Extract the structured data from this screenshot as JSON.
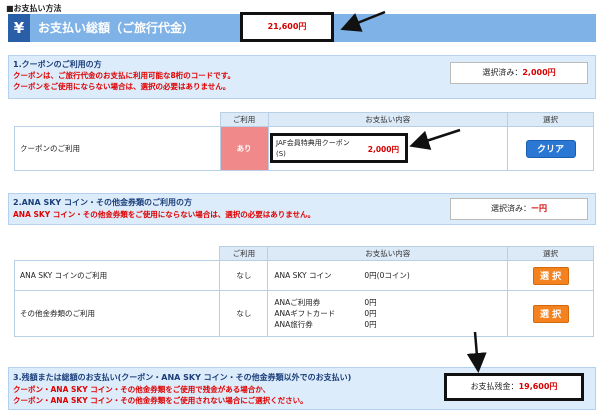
{
  "page_title": "■お支払い方法",
  "total": {
    "yen_symbol": "¥",
    "label": "お支払い総額（ご旅行代金）",
    "amount": "21,600円"
  },
  "coupon_section": {
    "title": "1.クーポンのご利用の方",
    "note1": "クーポンは、ご旅行代金のお支払に利用可能な8桁のコードです。",
    "note2": "クーポンをご使用にならない場合は、選択の必要はありません。",
    "selected_prefix": "選択済み：",
    "selected_amount": "2,000円",
    "headers": {
      "use": "ご利用",
      "content": "お支払い内容",
      "select": "選択"
    },
    "row": {
      "label": "クーポンのご利用",
      "use": "あり",
      "item_name": "JAF会員特典用クーポン(S)",
      "item_amount": "2,000円",
      "button": "クリア"
    }
  },
  "ana_section": {
    "title": "2.ANA SKY コイン・その他金券類のご利用の方",
    "note": "ANA SKY コイン・その他金券類をご使用にならない場合は、選択の必要はありません。",
    "selected_prefix": "選択済み：",
    "selected_amount": "ー円",
    "headers": {
      "use": "ご利用",
      "content": "お支払い内容",
      "select": "選択"
    },
    "rows": [
      {
        "label": "ANA SKY コインのご利用",
        "use": "なし",
        "items": [
          {
            "name": "ANA SKY コイン",
            "value": "0円(0コイン)"
          }
        ],
        "button": "選 択"
      },
      {
        "label": "その他金券類のご利用",
        "use": "なし",
        "items": [
          {
            "name": "ANAご利用券",
            "value": "0円"
          },
          {
            "name": "ANAギフトカード",
            "value": "0円"
          },
          {
            "name": "ANA旅行券",
            "value": "0円"
          }
        ],
        "button": "選 択"
      }
    ]
  },
  "balance_section": {
    "title": "3.残額または総額のお支払い(クーポン・ANA SKY コイン・その他金券類以外でのお支払い)",
    "note1": "クーポン・ANA SKY コイン・その他金券類をご使用で残金がある場合か、",
    "note2": "クーポン・ANA SKY コイン・その他金券類をご使用されない場合にご選択ください。",
    "remaining_prefix": "お支払残金：",
    "remaining_amount": "19,600円"
  },
  "colors": {
    "accent_blue": "#7fb2e6",
    "dark_blue": "#2a5fa8",
    "alert_red": "#e00000",
    "select_orange": "#f4821f",
    "clear_blue": "#2b78d4"
  }
}
